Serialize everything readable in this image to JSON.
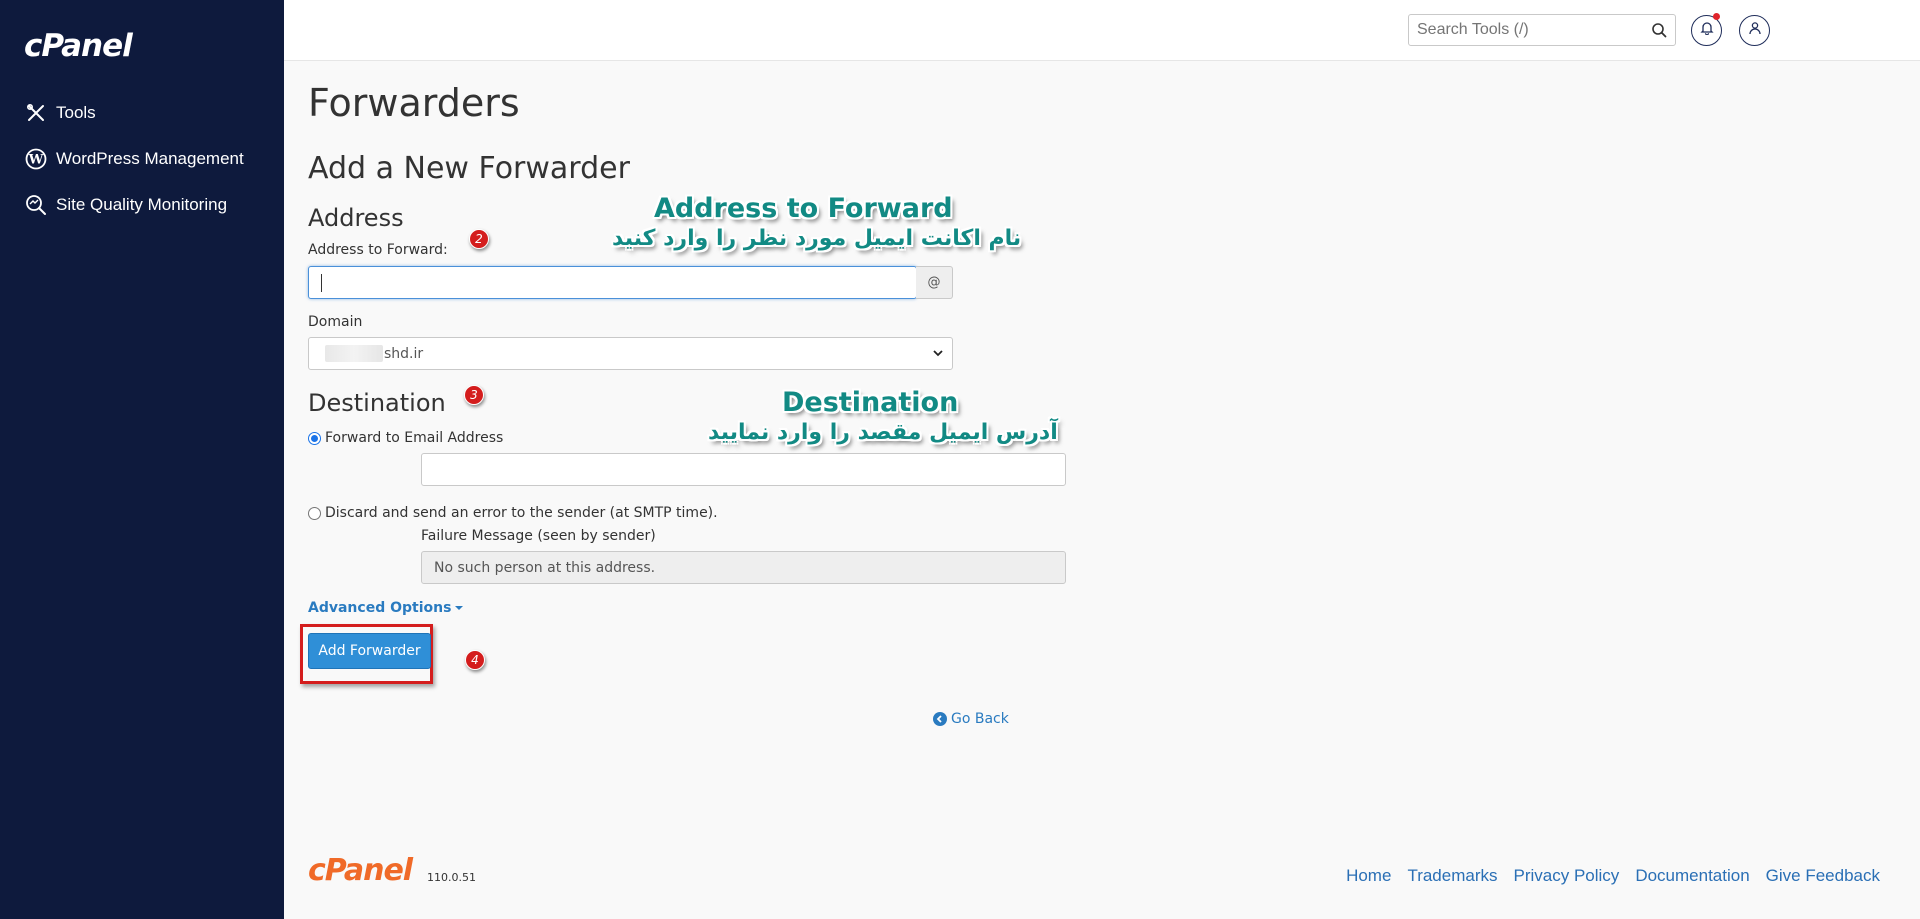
{
  "brand": {
    "logo_text": "cPanel"
  },
  "sidebar": {
    "items": [
      {
        "label": "Tools",
        "icon": "tools-icon"
      },
      {
        "label": "WordPress Management",
        "icon": "wordpress-icon"
      },
      {
        "label": "Site Quality Monitoring",
        "icon": "site-quality-icon"
      }
    ]
  },
  "header": {
    "search_placeholder": "Search Tools (/)"
  },
  "page": {
    "title": "Forwarders",
    "section_title": "Add a New Forwarder",
    "address": {
      "heading": "Address",
      "forward_label": "Address to Forward:",
      "forward_value": "",
      "at_symbol": "@",
      "domain_label": "Domain",
      "domain_value": "shd.ir"
    },
    "destination": {
      "heading": "Destination",
      "option_forward": "Forward to Email Address",
      "forward_email_value": "",
      "option_discard": "Discard and send an error to the sender (at SMTP time).",
      "failure_label": "Failure Message (seen by sender)",
      "failure_value": "No such person at this address."
    },
    "advanced_options": "Advanced Options",
    "add_button": "Add Forwarder",
    "go_back": "Go Back"
  },
  "annotations": {
    "badges": [
      "2",
      "3",
      "4"
    ],
    "address_title": "Address to Forward",
    "address_subtitle": "نام اکانت ایمیل مورد نظر را وارد کنید",
    "destination_title": "Destination",
    "destination_subtitle": "آدرس ایمیل مقصد را وارد نمایید"
  },
  "footer": {
    "logo_text": "cPanel",
    "version": "110.0.51",
    "links": [
      "Home",
      "Trademarks",
      "Privacy Policy",
      "Documentation",
      "Give Feedback"
    ]
  },
  "colors": {
    "sidebar_bg": "#0e1a3d",
    "accent": "#2f8fd7",
    "annotation": "#128a84",
    "badge": "#d41d1d",
    "footer_logo": "#f06a28"
  }
}
